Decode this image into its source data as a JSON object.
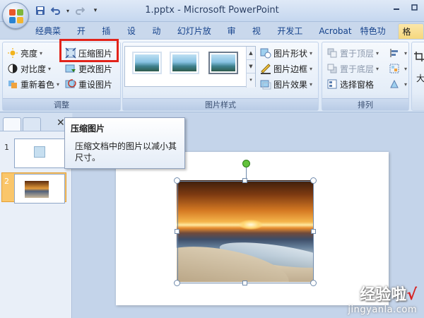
{
  "window": {
    "title": "1.pptx - Microsoft PowerPoint"
  },
  "tabs": [
    "经典菜单",
    "开始",
    "插入",
    "设计",
    "动画",
    "幻灯片放映",
    "审阅",
    "视图",
    "开发工具",
    "Acrobat",
    "特色功能",
    "格式"
  ],
  "selected_tab": "格式",
  "ribbon": {
    "adjust": {
      "label": "调整",
      "brightness": "亮度",
      "contrast": "对比度",
      "recolor": "重新着色",
      "compress": "压缩图片",
      "change": "更改图片",
      "reset": "重设图片"
    },
    "styles": {
      "label": "图片样式",
      "shape": "图片形状",
      "border": "图片边框",
      "effects": "图片效果"
    },
    "arrange": {
      "label": "排列",
      "bring_front": "置于顶层",
      "send_back": "置于底层",
      "selection_pane": "选择窗格"
    },
    "size_partial": "大"
  },
  "tooltip": {
    "title": "压缩图片",
    "body": "压缩文档中的图片以减小其尺寸。"
  },
  "slides_pane": {
    "close": "✕",
    "slides": [
      {
        "number": "1"
      },
      {
        "number": "2"
      }
    ]
  },
  "watermark": {
    "brand": "经验啦",
    "domain": "jingyanla.com"
  },
  "colors": {
    "highlight": "#e2231a",
    "context_tab": "#f5d87e",
    "selected_slide": "#fac66a"
  }
}
